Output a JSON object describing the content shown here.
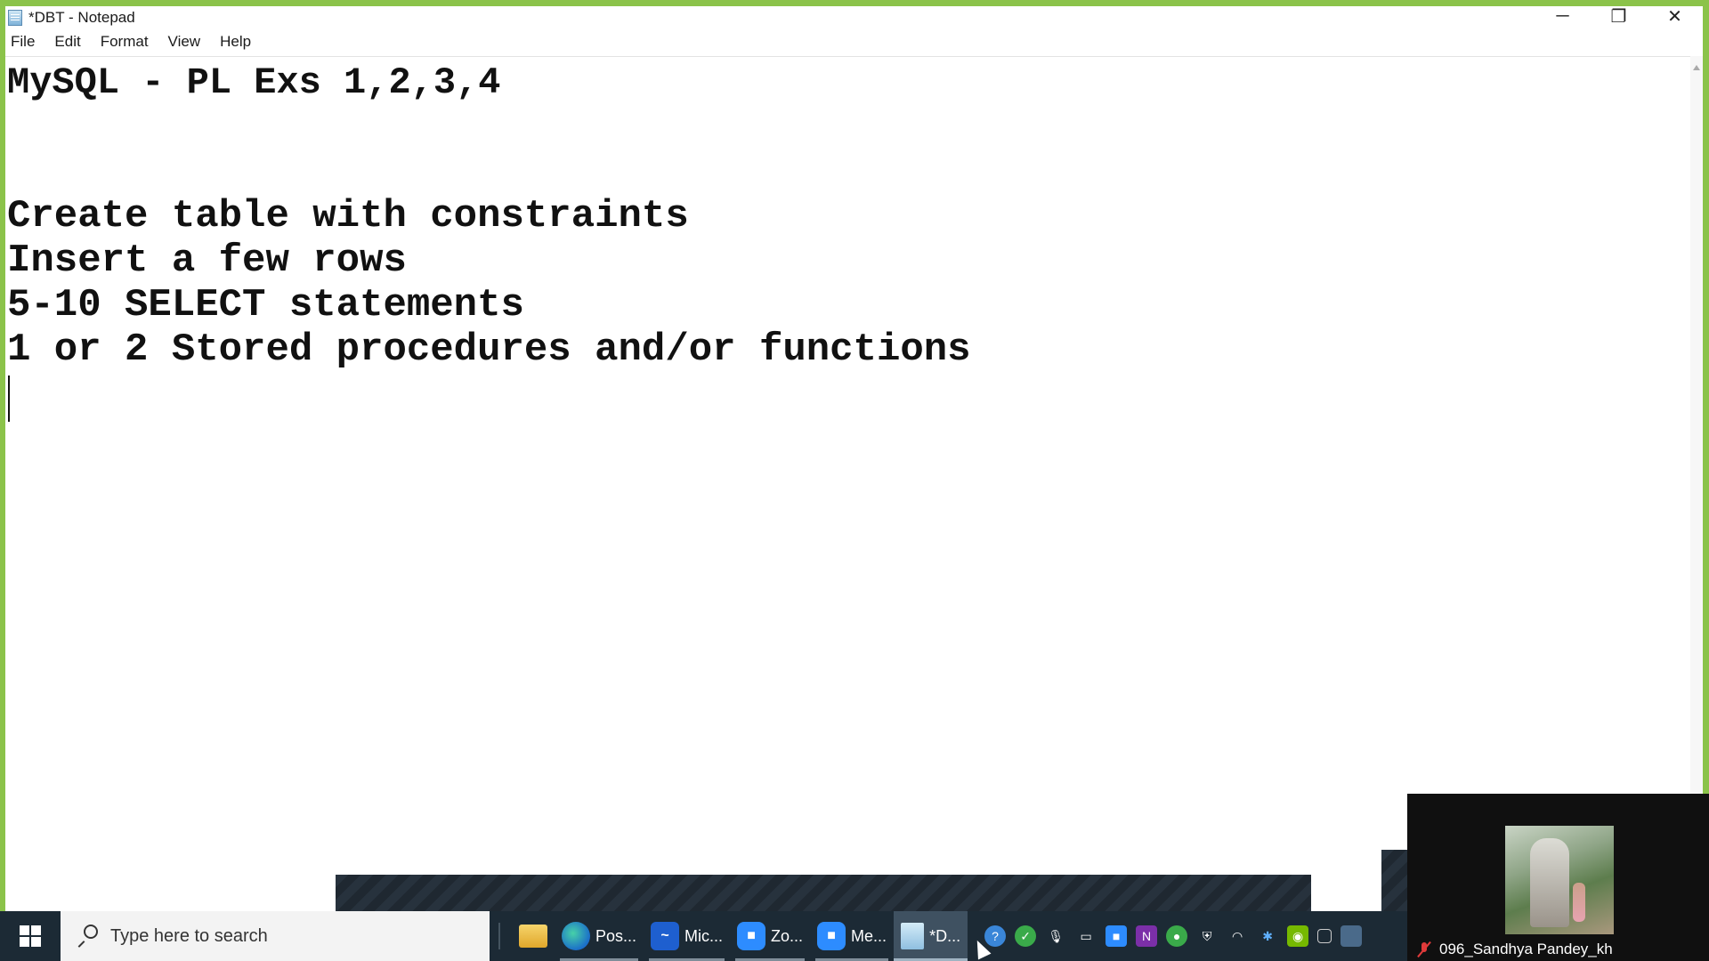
{
  "window": {
    "title": "*DBT - Notepad",
    "controls": {
      "minimize": "─",
      "restore": "❐",
      "close": "✕"
    }
  },
  "menu": [
    "File",
    "Edit",
    "Format",
    "View",
    "Help"
  ],
  "editor": {
    "lines": [
      "MySQL - PL Exs 1,2,3,4",
      "",
      "",
      "Create table with constraints",
      "Insert a few rows",
      "5-10 SELECT statements",
      "1 or 2 Stored procedures and/or functions"
    ]
  },
  "taskbar": {
    "search_placeholder": "Type here to search",
    "apps": [
      {
        "name": "file-explorer",
        "label": "",
        "icon": "folder-icon"
      },
      {
        "name": "edge",
        "label": "Pos...",
        "icon": "edge-icon"
      },
      {
        "name": "whiteboard",
        "label": "Mic...",
        "icon": "whiteboard-icon"
      },
      {
        "name": "zoom",
        "label": "Zo...",
        "icon": "zoom-icon"
      },
      {
        "name": "zoom-meeting",
        "label": "Me...",
        "icon": "zoom-icon"
      },
      {
        "name": "notepad",
        "label": "*D...",
        "icon": "notepad-icon"
      }
    ],
    "tray_icons": [
      "help-icon",
      "shield-check-icon",
      "microphone-icon",
      "battery-icon",
      "zoom-tray-icon",
      "onenote-icon",
      "status-icon",
      "security-icon",
      "network-icon",
      "bluetooth-icon",
      "nvidia-icon",
      "display-icon",
      "app-icon"
    ]
  },
  "video_tile": {
    "participant_name": "096_Sandhya Pandey_kh"
  },
  "colors": {
    "window_border": "#8bc34a",
    "taskbar_bg": "#1c2a35"
  }
}
